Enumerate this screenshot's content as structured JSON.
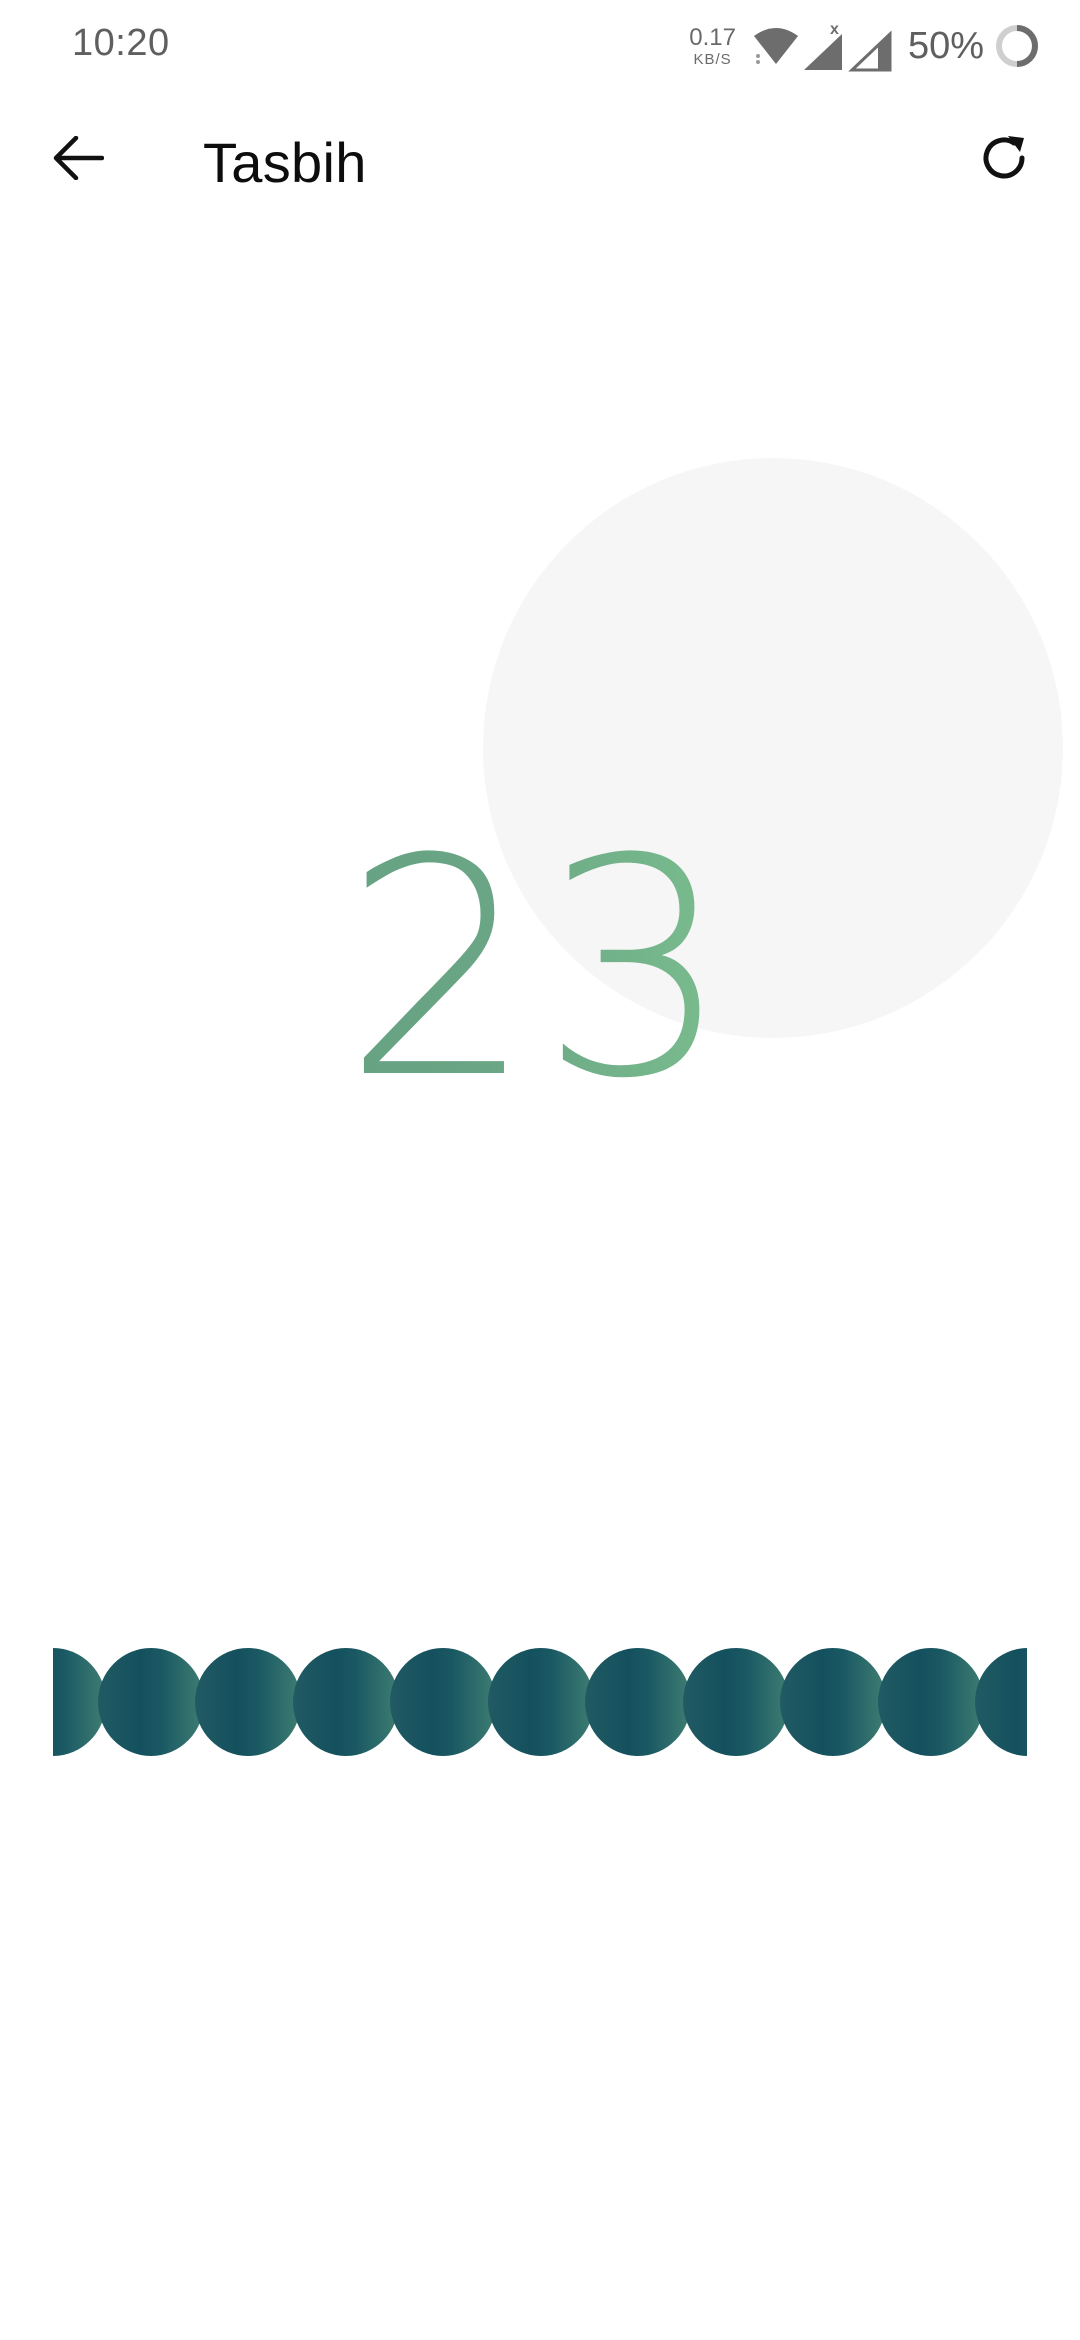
{
  "status_bar": {
    "time": "10:20",
    "net_speed_value": "0.17",
    "net_speed_unit": "KB/S",
    "battery_percent": "50%",
    "icons": [
      "wifi-icon",
      "signal-icon",
      "signal-icon-2",
      "battery-ring-icon"
    ]
  },
  "app_bar": {
    "title": "Tasbih",
    "back_icon": "arrow-left-icon",
    "reset_icon": "refresh-icon"
  },
  "counter": {
    "value": "23"
  },
  "colors": {
    "counter_gradient_start": "#5d9a7e",
    "counter_gradient_end": "#7bbe8c",
    "bead_dark": "#14505e",
    "bead_light": "#3f7e72",
    "tap_circle": "#f6f6f6"
  },
  "beads": {
    "visible_count": 11,
    "icon": "bead-icon"
  }
}
